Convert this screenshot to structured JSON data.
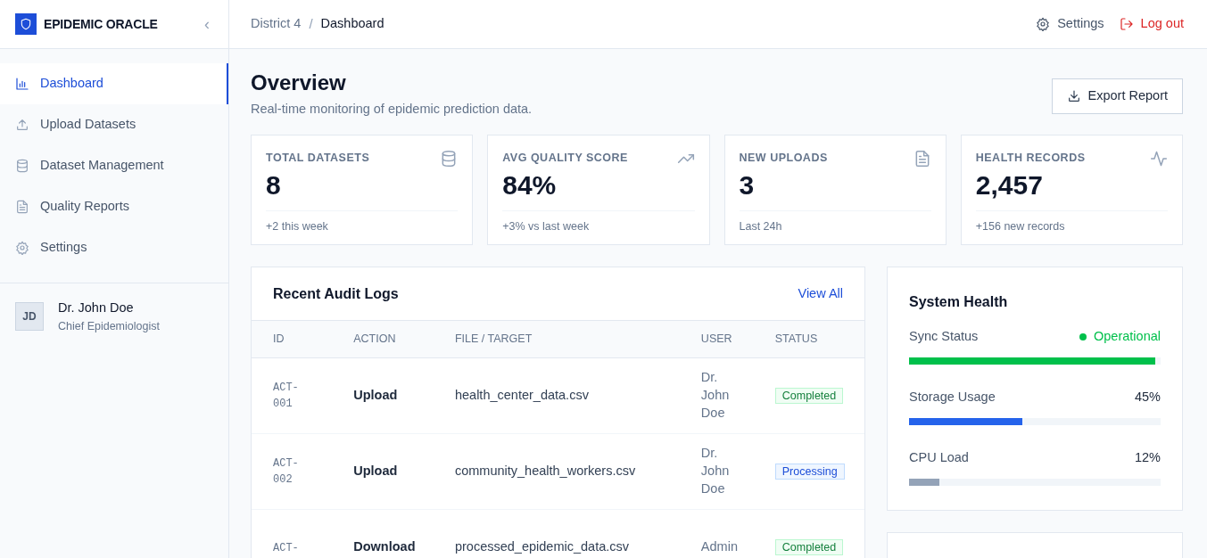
{
  "sidebar": {
    "brand": "EPIDEMIC ORACLE",
    "collapse": "‹",
    "items": [
      {
        "label": "Dashboard",
        "selected": true
      },
      {
        "label": "Upload Datasets",
        "selected": false
      },
      {
        "label": "Dataset Management",
        "selected": false
      },
      {
        "label": "Quality Reports",
        "selected": false
      },
      {
        "label": "Settings",
        "selected": false
      }
    ],
    "user": {
      "initials": "JD",
      "name": "Dr. John Doe",
      "role": "Chief Epidemiologist"
    }
  },
  "header": {
    "breadcrumb": [
      "District 4",
      "Dashboard"
    ],
    "separator": "/",
    "settings": "Settings",
    "logout": "Log out"
  },
  "page": {
    "title": "Overview",
    "subtitle": "Real-time monitoring of epidemic prediction data.",
    "export": "Export Report"
  },
  "stats": [
    {
      "label": "TOTAL DATASETS",
      "value": "8",
      "note": "+2 this week"
    },
    {
      "label": "AVG QUALITY SCORE",
      "value": "84%",
      "note": "+3% vs last week"
    },
    {
      "label": "NEW UPLOADS",
      "value": "3",
      "note": "Last 24h"
    },
    {
      "label": "HEALTH RECORDS",
      "value": "2,457",
      "note": "+156 new records"
    }
  ],
  "audit": {
    "title": "Recent Audit Logs",
    "view_all": "View All",
    "columns": [
      "ID",
      "ACTION",
      "FILE / TARGET",
      "USER",
      "STATUS"
    ],
    "rows": [
      {
        "id": "ACT-001",
        "action": "Upload",
        "file": "health_center_data.csv",
        "user": "Dr. John Doe",
        "status": "Completed",
        "kind": "success"
      },
      {
        "id": "ACT-002",
        "action": "Upload",
        "file": "community_health_workers.csv",
        "user": "Dr. John Doe",
        "status": "Processing",
        "kind": "info"
      },
      {
        "id": "ACT-",
        "action": "Download",
        "file": "processed_epidemic_data.csv",
        "user": "Admin",
        "status": "Completed",
        "kind": "success"
      }
    ]
  },
  "health": {
    "title": "System Health",
    "metrics": [
      {
        "label": "Sync Status",
        "reading": "Operational",
        "kind": "status",
        "color": "#00c04b",
        "level": 0.98
      },
      {
        "label": "Storage Usage",
        "reading": "45%",
        "kind": "percent",
        "color": "#2563eb",
        "level": 0.45
      },
      {
        "label": "CPU Load",
        "reading": "12%",
        "kind": "percent",
        "color": "#94a3b8",
        "level": 0.12
      }
    ]
  }
}
